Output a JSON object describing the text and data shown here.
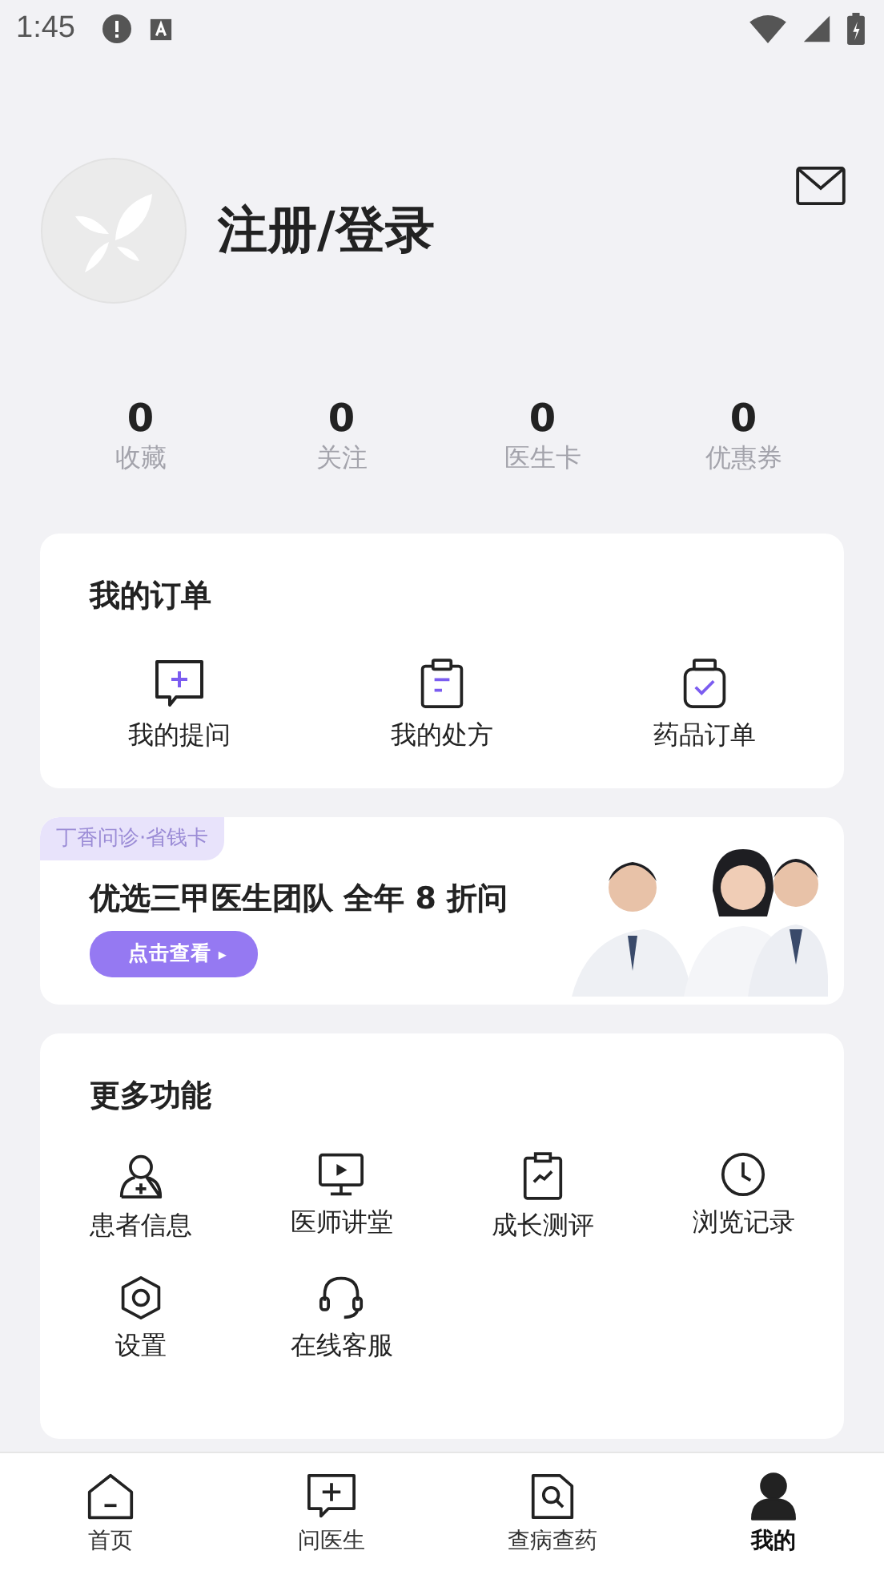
{
  "status_bar": {
    "time": "1:45"
  },
  "profile": {
    "login_label": "注册/登录"
  },
  "stats": [
    {
      "value": "0",
      "label": "收藏"
    },
    {
      "value": "0",
      "label": "关注"
    },
    {
      "value": "0",
      "label": "医生卡"
    },
    {
      "value": "0",
      "label": "优惠券"
    }
  ],
  "orders": {
    "title": "我的订单",
    "items": [
      {
        "kind": "question",
        "label": "我的提问"
      },
      {
        "kind": "prescription",
        "label": "我的处方"
      },
      {
        "kind": "medicine",
        "label": "药品订单"
      }
    ]
  },
  "banner": {
    "tag": "丁香问诊·省钱卡",
    "headline": "优选三甲医生团队 全年 8 折问",
    "button": "点击查看",
    "arrow": "▸"
  },
  "more": {
    "title": "更多功能",
    "items": [
      {
        "kind": "patient",
        "label": "患者信息"
      },
      {
        "kind": "lecture",
        "label": "医师讲堂"
      },
      {
        "kind": "growth",
        "label": "成长测评"
      },
      {
        "kind": "history",
        "label": "浏览记录"
      },
      {
        "kind": "settings",
        "label": "设置"
      },
      {
        "kind": "service",
        "label": "在线客服"
      }
    ]
  },
  "tab_bar": [
    {
      "kind": "home",
      "label": "首页",
      "selected": false
    },
    {
      "kind": "ask",
      "label": "问医生",
      "selected": false
    },
    {
      "kind": "search",
      "label": "查病查药",
      "selected": false
    },
    {
      "kind": "me",
      "label": "我的",
      "selected": true
    }
  ]
}
